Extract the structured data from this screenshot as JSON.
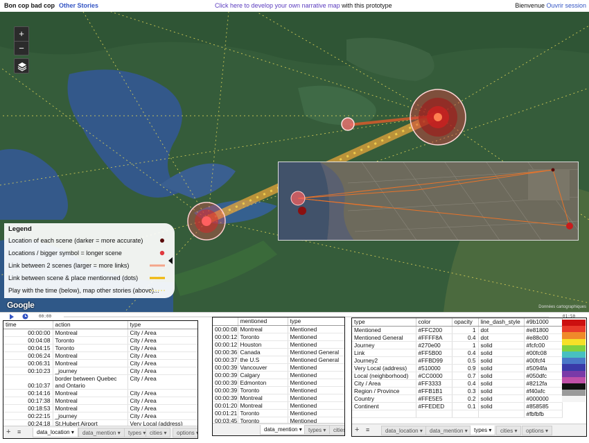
{
  "topbar": {
    "app_title": "Bon cop bad cop",
    "other_stories": "Other Stories",
    "develop_link": "Click here to develop your own narrative map",
    "develop_suffix": " with this prototype",
    "welcome": "Bienvenue",
    "open_session": "Ouvrir session"
  },
  "map": {
    "zoom_in": "+",
    "zoom_out": "−",
    "google": "Google",
    "credit": "Données cartographiques"
  },
  "legend": {
    "title": "Legend",
    "items": [
      {
        "label": "Location of each scene (darker = more accurate)",
        "symbol": "dark-dot",
        "color": "#5a0a0a"
      },
      {
        "label": "Locations / bigger symbol = longer scene",
        "symbol": "red-dot",
        "color": "#e0393e"
      },
      {
        "label": "Link between 2 scenes (larger = more links)",
        "symbol": "pink-line",
        "color": "#f4a58a"
      },
      {
        "label": "Link between scene & place mentionned (dots)",
        "symbol": "orange-line",
        "color": "#f0b400"
      },
      {
        "label": "Play with the time (below), map other stories (above)...",
        "symbol": "dotted-line",
        "color": "#f2e27a"
      }
    ]
  },
  "timeline": {
    "start": "00:00",
    "end": "01:50"
  },
  "location_table": {
    "headers": [
      "time",
      "action",
      "type"
    ],
    "rows": [
      [
        "00:00:00",
        "Montreal",
        "City / Area"
      ],
      [
        "00:04:08",
        "Toronto",
        "City / Area"
      ],
      [
        "00:04:15",
        "Toronto",
        "City / Area"
      ],
      [
        "00:06:24",
        "Montreal",
        "City / Area"
      ],
      [
        "00:06:31",
        "Montreal",
        "City / Area"
      ],
      [
        "00:10:23",
        "_journey",
        "City / Area"
      ],
      [
        "00:10:37",
        "border between Quebec and Ontario",
        "City / Area"
      ],
      [
        "00:14:16",
        "Montreal",
        "City / Area"
      ],
      [
        "00:17:38",
        "Montreal",
        "City / Area"
      ],
      [
        "00:18:53",
        "Montreal",
        "City / Area"
      ],
      [
        "00:22:15",
        "_journey",
        "City / Area"
      ],
      [
        "00:24:18",
        "St.Hubert Airport",
        "Very Local (address)"
      ]
    ],
    "tabs": [
      "data_location",
      "data_mention",
      "types",
      "cities",
      "options"
    ]
  },
  "mention_table": {
    "headers": [
      "",
      "mentioned",
      "type"
    ],
    "rows": [
      [
        "00:00:08",
        "Montreal",
        "Mentioned"
      ],
      [
        "00:00:12",
        "Toronto",
        "Mentioned"
      ],
      [
        "00:00:12",
        "Houston",
        "Mentioned"
      ],
      [
        "00:00:36",
        "Canada",
        "Mentioned General"
      ],
      [
        "00:00:37",
        "the U.S",
        "Mentioned General"
      ],
      [
        "00:00:39",
        "Vancouver",
        "Mentioned"
      ],
      [
        "00:00:39",
        "Calgary",
        "Mentioned"
      ],
      [
        "00:00:39",
        "Edmonton",
        "Mentioned"
      ],
      [
        "00:00:39",
        "Toronto",
        "Mentioned"
      ],
      [
        "00:00:39",
        "Montreal",
        "Mentioned"
      ],
      [
        "00:01:20",
        "Montreal",
        "Mentioned"
      ],
      [
        "00:01:21",
        "Toronto",
        "Mentioned"
      ],
      [
        "00:03:45",
        "Toronto",
        "Mentioned"
      ]
    ],
    "tabs": [
      "data_mention",
      "types",
      "cities"
    ]
  },
  "types_table": {
    "headers": [
      "type",
      "color",
      "opacity",
      "line_dash_style",
      "#9b1000"
    ],
    "rows": [
      [
        "Mentioned",
        "#FFC200",
        "1",
        "dot",
        "#e81800"
      ],
      [
        "Mentioned General",
        "#FFFF8A",
        "0.4",
        "dot",
        "#e88c00"
      ],
      [
        "Journey",
        "#270e00",
        "1",
        "solid",
        "#fcfc00"
      ],
      [
        "Link",
        "#FF5B00",
        "0.4",
        "solid",
        "#00fc08"
      ],
      [
        "Journey2",
        "#FFBD99",
        "0.5",
        "solid",
        "#00fcf4"
      ],
      [
        "Very Local (address)",
        "#510000",
        "0.9",
        "solid",
        "#5094fa"
      ],
      [
        "Local (neighborhood)",
        "#CC0000",
        "0.7",
        "solid",
        "#050dfc"
      ],
      [
        "City / Area",
        "#FF3333",
        "0.4",
        "solid",
        "#8212fa"
      ],
      [
        "Region / Province",
        "#FFB1B1",
        "0.3",
        "solid",
        "#f40afc"
      ],
      [
        "Country",
        "#FFE5E5",
        "0.2",
        "solid",
        "#000000"
      ],
      [
        "Continent",
        "#FFEDED",
        "0.1",
        "solid",
        "#858585"
      ],
      [
        "",
        "",
        "",
        "",
        "#fbfbfb"
      ]
    ],
    "tabs": [
      "data_location",
      "data_mention",
      "types",
      "cities",
      "options"
    ],
    "swatches": [
      "#cc1010",
      "#e83a2a",
      "#f08a2a",
      "#f5e028",
      "#7fd040",
      "#48c0c0",
      "#4a78c8",
      "#3a3aa8",
      "#7a3aa8",
      "#c050a8",
      "#111111",
      "#9a9a9a",
      "#f4f4f4"
    ]
  }
}
